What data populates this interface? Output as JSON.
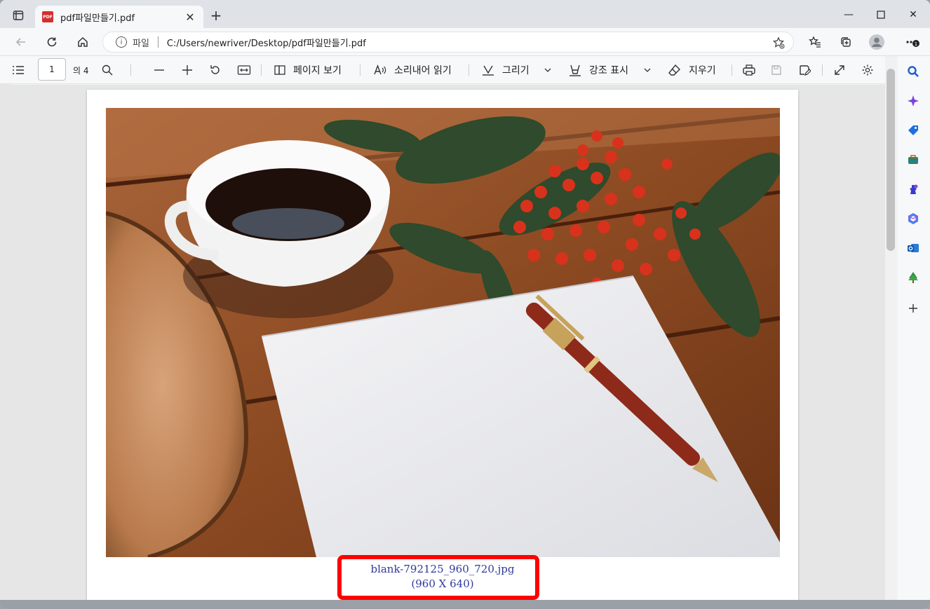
{
  "tab": {
    "title": "pdf파일만들기.pdf",
    "favicon": "PDF"
  },
  "address": {
    "scheme_label": "파일",
    "url": "C:/Users/newriver/Desktop/pdf파일만들기.pdf"
  },
  "pdf_toolbar": {
    "page_number": "1",
    "page_total": "의 4",
    "page_view": "페이지 보기",
    "read_aloud": "소리내어 읽기",
    "draw": "그리기",
    "highlight": "강조 표시",
    "erase": "지우기"
  },
  "document": {
    "caption_line1": "blank-792125_960_720.jpg",
    "caption_line2": "(960 X 640)"
  },
  "colors": {
    "highlight_box": "#ff0000",
    "caption_text": "#2e3a9c"
  }
}
